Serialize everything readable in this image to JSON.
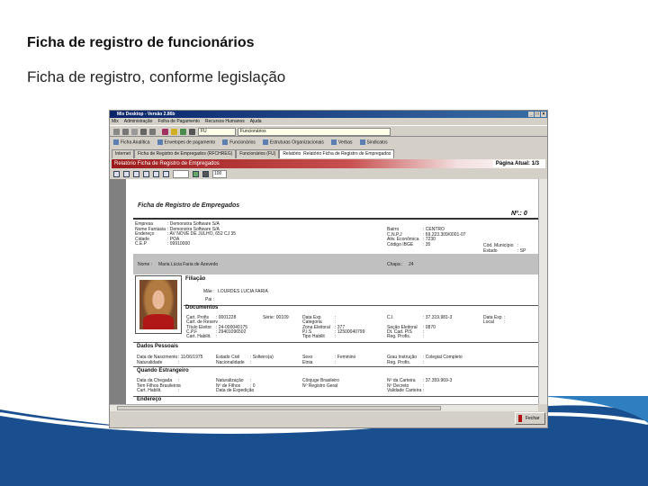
{
  "slide": {
    "title": "Ficha de registro de funcionários",
    "subtitle": "Ficha de registro, conforme legislação"
  },
  "window": {
    "title": "Mix Desktop - Versão 2.86b",
    "controls": [
      "_",
      "□",
      "×"
    ],
    "menu": [
      "Mix",
      "Administração",
      "Folha de Pagamento",
      "Recursos Humanos",
      "Ajuda"
    ],
    "code_field": "FU",
    "name_field": "Funcionários",
    "shortcuts": [
      "Ficha Analítica",
      "Envelopes de pagamento",
      "Funcionários",
      "Estruturas Organizacionais",
      "Verbas",
      "Sindicatos"
    ],
    "tabs": [
      "Internet",
      "Ficha de Registro de Empregados (RFCHREG)",
      "Funcionários (FU)",
      "Relatório",
      "Relatório Ficha de Registro de Empregados"
    ],
    "report_header": "Relatório Ficha de Registro de Empregados",
    "page_info": "Página Atual: 1/3",
    "zoom": "100",
    "close_label": "Fechar"
  },
  "report": {
    "title": "Ficha de Registro de Empregados",
    "number": "Nº.: 0",
    "company": [
      [
        "Empresa",
        ": Demonstra Software S/A"
      ],
      [
        "Nome Fantasia",
        ": Demonstra Software S/A"
      ],
      [
        "Endereço",
        ": AV NOVE DE JULHO, 652 CJ 35"
      ],
      [
        "Cidade",
        ": POA"
      ],
      [
        "C.E.P",
        ": 09910000"
      ]
    ],
    "company2": [
      [
        "Bairro",
        ": CENTRO"
      ],
      [
        "C.N.P.J",
        ": 69.223.309/0001-07"
      ],
      [
        "Ativ. Econômica",
        ": 7230"
      ],
      [
        "Código IBGE",
        ": 35"
      ]
    ],
    "company3": [
      [
        "Cód. Município",
        ":"
      ],
      [
        "Estado",
        ": SP"
      ]
    ],
    "name_label": "Nome :",
    "name": "Maria Lúcia Faria de Azevedo",
    "chapa_label": "Chapa :",
    "chapa": "24",
    "filiacao": "Filiação",
    "mae_label": "Mãe :",
    "mae": "LOURDES LUCIA FARIA",
    "pai_label": "Pai :",
    "documentos": "Documentos",
    "docs": [
      [
        "Cart. Profis",
        ": 0001228",
        "Série",
        ": 00109",
        "Data Exp",
        ":",
        "C.I.",
        ": 37.319.981-3",
        "Data Exp",
        ":"
      ],
      [
        "Cart. de Reserv",
        "",
        "",
        "",
        "Categoria",
        ":",
        "",
        "",
        "Local",
        ":"
      ],
      [
        "Título Eleitor",
        ": 24-000040175",
        "",
        "",
        "Zona Eleitoral",
        ": 377",
        "Seção Eleitoral",
        ": 0870",
        "",
        ""
      ],
      [
        "C.P.F",
        ": 29401096502",
        "",
        "",
        "P.I.S",
        ": 12500040799",
        "Dt. Cad. PIS",
        ":",
        "",
        ""
      ],
      [
        "Cart. Habilit.",
        ":",
        "",
        "",
        "Tipo Habilit",
        ":",
        "Reg. Profis.",
        ":",
        "",
        ""
      ]
    ],
    "dados_pessoais": "Dados Pessoais",
    "pessoais": [
      [
        "Data de Nascimento",
        ": 11/06/1975",
        "Estado Civil",
        ": Solteiro(a)",
        "Sexo",
        ": Feminino",
        "Grau Instrução",
        ": Colegial Completo"
      ],
      [
        "Naturalidade",
        ":",
        "Nacionalidade",
        ":",
        "Etnia",
        ":",
        "Reg. Profis.",
        ":"
      ]
    ],
    "estrangeiro": "Quando Estrangeiro",
    "estr": [
      [
        "Data da Chegada",
        ":",
        "Naturalização",
        ":",
        "Cônjuge Brasileiro",
        ":",
        "Nº da Carteira",
        ": 37.359.969-3"
      ],
      [
        "Tem Filhos Brasileiros",
        ":",
        "Nº de Filhos",
        ": 0",
        "Nº Registro Geral",
        ":",
        "Nº Decreto",
        ":"
      ],
      [
        "Cart. Habilit.",
        ":",
        "Data de Expedição",
        ":",
        "",
        "",
        "Validade Carteira",
        ":"
      ]
    ],
    "endereco": "Endereço"
  }
}
